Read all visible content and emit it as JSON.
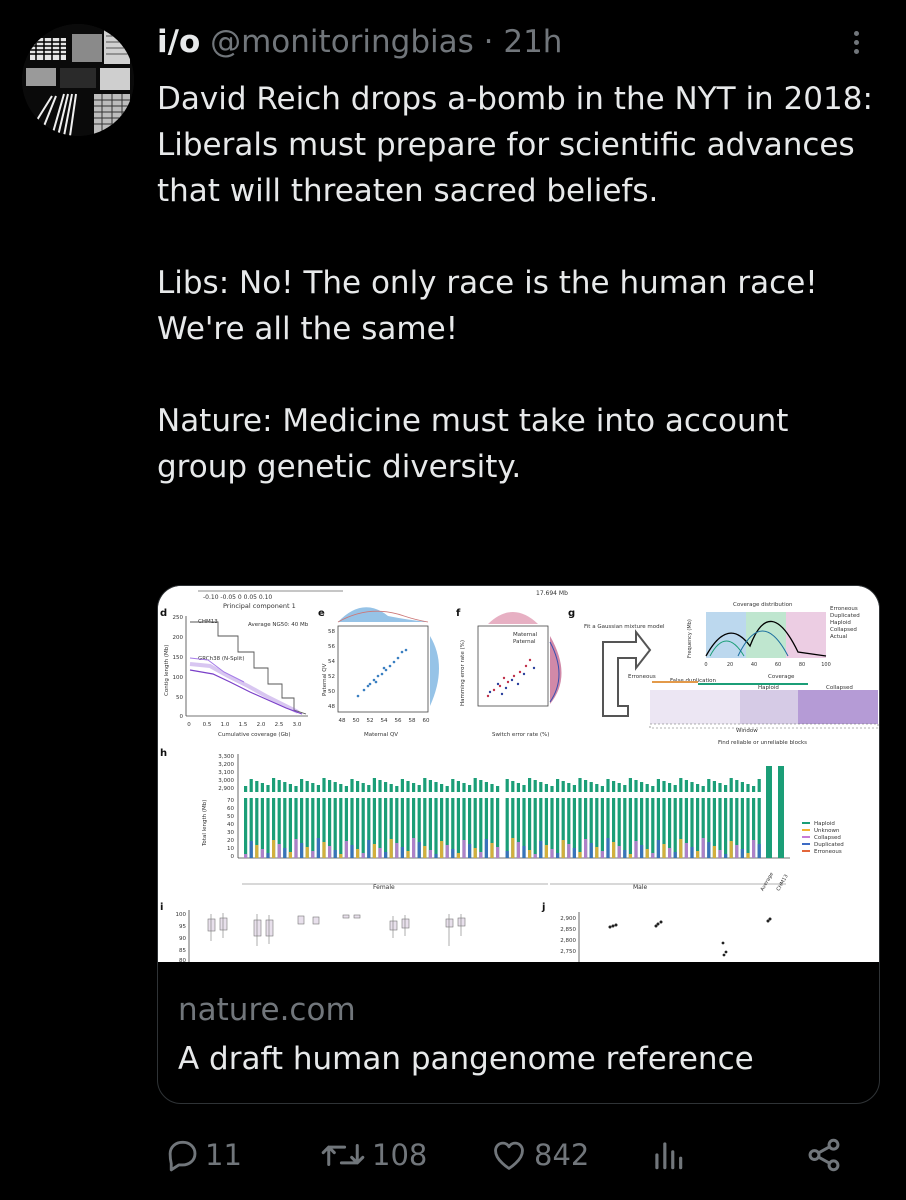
{
  "tweet": {
    "display_name": "i/o",
    "handle": "@monitoringbias",
    "separator": "·",
    "time": "21h",
    "paragraphs": [
      "David Reich drops a-bomb in the NYT in 2018: Liberals must prepare for scientific advances that will threaten sacred beliefs.",
      "Libs: No! The only race is the human race! We're all the same!",
      "Nature: Medicine must take into account group genetic diversity."
    ]
  },
  "card": {
    "domain": "nature.com",
    "title": "A draft human pangenome reference",
    "figure": {
      "axis_texts": {
        "pc_ticks": "-0.10   -0.05   0    0.05   0.10",
        "pc_label": "Principal component 1",
        "d": "d",
        "e": "e",
        "f": "f",
        "g": "g",
        "h": "h",
        "i": "i",
        "j": "j",
        "d_y_label": "Contig length (Mb)",
        "d_x_label": "Cumulative coverage (Gb)",
        "d_x_ticks": [
          "0",
          "0.5",
          "1.0",
          "1.5",
          "2.0",
          "2.5",
          "3.0"
        ],
        "d_y_ticks": [
          "250",
          "200",
          "150",
          "100",
          "50",
          "0"
        ],
        "d_chm13": "CHM13",
        "d_grch38": "GRCh38 (N-Split)",
        "d_ng50": "Average NG50: 40 Mb",
        "e_y_label": "Paternal QV",
        "e_x_label": "Maternal QV",
        "e_x_ticks": [
          "48",
          "50",
          "52",
          "54",
          "56",
          "58",
          "60"
        ],
        "e_y_ticks": [
          "58",
          "56",
          "54",
          "52",
          "50",
          "48"
        ],
        "f_y_label": "Hamming error rate (%)",
        "f_x_label": "Switch error rate (%)",
        "f_legend_maternal": "Maternal",
        "f_legend_paternal": "Paternal",
        "g_text": "Fit a Gaussian mixture model",
        "g_cov_title": "Coverage distribution",
        "g_legend": [
          "Erroneous",
          "Duplicated",
          "Haploid",
          "Collapsed",
          "Actual"
        ],
        "g_labels": [
          "Erroneous",
          "False duplication",
          "Haploid",
          "Collapsed",
          "Coverage",
          "Window",
          "Find reliable or unreliable blocks"
        ],
        "g_y_label": "Frequency (Mb)",
        "g_x_ticks": [
          "0",
          "20",
          "40",
          "60",
          "80",
          "100"
        ],
        "top_right": "17.694 Mb",
        "h_y_label": "Total length (Mb)",
        "h_y_ticks_top": [
          "3,300",
          "3,200",
          "3,100",
          "3,000",
          "2,900"
        ],
        "h_y_ticks_bottom": [
          "70",
          "60",
          "50",
          "40",
          "30",
          "20",
          "10",
          "0"
        ],
        "h_legend": [
          "Haploid",
          "Unknown",
          "Collapsed",
          "Duplicated",
          "Erroneous"
        ],
        "h_female": "Female",
        "h_male": "Male",
        "h_extra": [
          "Average",
          "CHM13"
        ],
        "i_y_ticks": [
          "100",
          "95",
          "90",
          "85",
          "80"
        ],
        "j_y_ticks": [
          "2,900",
          "2,850",
          "2,800",
          "2,750"
        ]
      }
    }
  },
  "actions": {
    "replies": "11",
    "reposts": "108",
    "likes": "842"
  },
  "colors": {
    "background": "#000000",
    "text": "#e7e9ea",
    "muted": "#71767b",
    "border": "#2f3336",
    "haploid": "#1b9e77",
    "collapsed": "#7b3294"
  },
  "icons": [
    "avatar-photo",
    "more-options-icon",
    "reply-icon",
    "repost-icon",
    "like-icon",
    "views-icon",
    "share-icon"
  ]
}
